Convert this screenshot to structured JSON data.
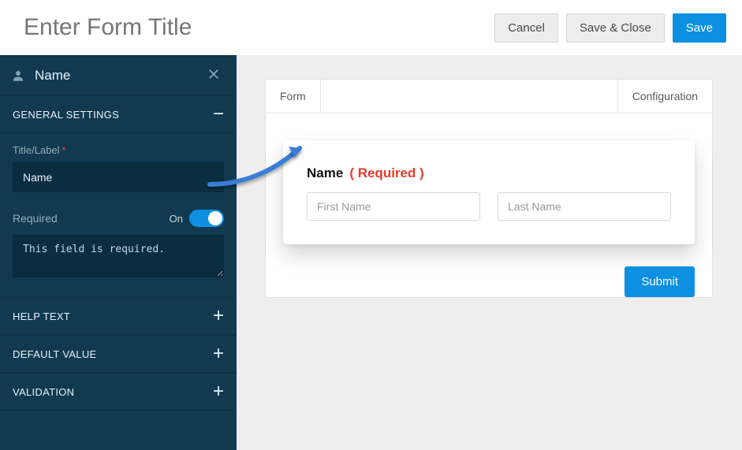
{
  "header": {
    "title_placeholder": "Enter Form Title",
    "buttons": {
      "cancel": "Cancel",
      "save_close": "Save & Close",
      "save": "Save"
    }
  },
  "sidebar": {
    "field_name": "Name",
    "sections": {
      "general": {
        "label": "GENERAL SETTINGS",
        "title_label": "Title/Label",
        "title_value": "Name",
        "required_label": "Required",
        "toggle_state": "On",
        "required_message": "This field is required."
      },
      "help_text": {
        "label": "HELP TEXT"
      },
      "default_value": {
        "label": "DEFAULT VALUE"
      },
      "validation": {
        "label": "VALIDATION"
      }
    }
  },
  "preview": {
    "tabs": {
      "form": "Form",
      "config": "Configuration"
    },
    "field": {
      "label": "Name",
      "required_text": "( Required )",
      "first_placeholder": "First Name",
      "last_placeholder": "Last Name"
    },
    "submit": "Submit"
  },
  "colors": {
    "accent": "#0d90e2",
    "sidebar": "#113a50",
    "required": "#e83a2e"
  }
}
